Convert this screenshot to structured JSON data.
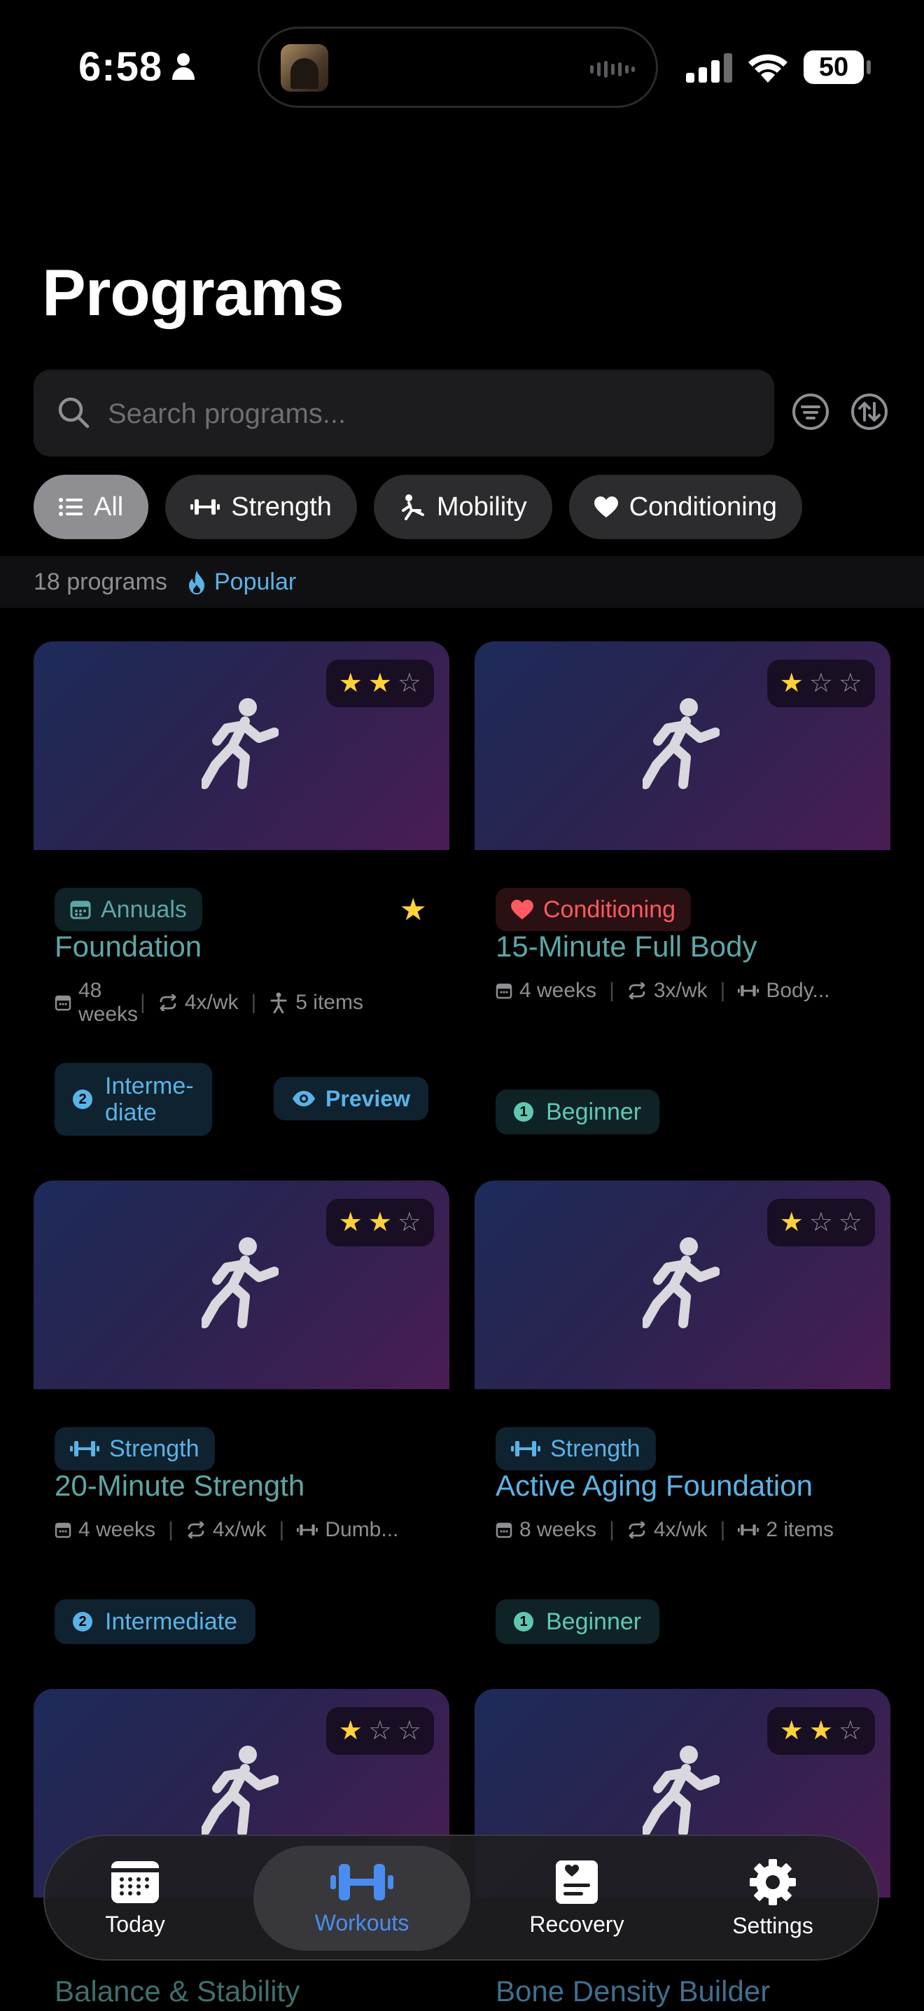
{
  "status": {
    "time": "6:58",
    "battery": "50"
  },
  "page": {
    "title": "Programs"
  },
  "search": {
    "placeholder": "Search programs..."
  },
  "filters": [
    {
      "label": "All",
      "icon": "list-icon",
      "active": true
    },
    {
      "label": "Strength",
      "icon": "dumbbell-icon"
    },
    {
      "label": "Mobility",
      "icon": "stretch-icon"
    },
    {
      "label": "Conditioning",
      "icon": "heart-icon"
    }
  ],
  "summary": {
    "count": "18 programs",
    "sort_label": "Popular"
  },
  "programs": [
    {
      "category": "Annuals",
      "title": "Foundation",
      "stars": 2,
      "favorite": true,
      "duration": "48 weeks",
      "frequency": "4x/wk",
      "equipment": "5 items",
      "level_num": "2",
      "level": "Interme-diate",
      "level_line1": "Interme-",
      "level_line2": "diate",
      "preview": "Preview"
    },
    {
      "category": "Conditioning",
      "title": "15-Minute Full Body",
      "stars": 1,
      "duration": "4 weeks",
      "frequency": "3x/wk",
      "equipment": "Body...",
      "level_num": "1",
      "level": "Beginner"
    },
    {
      "category": "Strength",
      "title": "20-Minute Strength",
      "stars": 2,
      "duration": "4 weeks",
      "frequency": "4x/wk",
      "equipment": "Dumb...",
      "level_num": "2",
      "level": "Intermediate"
    },
    {
      "category": "Strength",
      "title": "Active Aging Foundation",
      "stars": 1,
      "duration": "8 weeks",
      "frequency": "4x/wk",
      "equipment": "2 items",
      "level_num": "1",
      "level": "Beginner"
    },
    {
      "title": "Balance & Stability",
      "stars": 1
    },
    {
      "title": "Bone Density Builder",
      "stars": 2
    }
  ],
  "tabs": [
    {
      "label": "Today",
      "icon": "calendar-icon"
    },
    {
      "label": "Workouts",
      "icon": "dumbbell-icon",
      "active": true
    },
    {
      "label": "Recovery",
      "icon": "clipboard-heart-icon"
    },
    {
      "label": "Settings",
      "icon": "gear-icon"
    }
  ],
  "colors": {
    "accent_blue": "#5ab3e6",
    "teal": "#5ea6a6",
    "conditioning_red": "#ff5a5f",
    "star_yellow": "#ffd23a",
    "tab_active": "#4a8df0"
  }
}
